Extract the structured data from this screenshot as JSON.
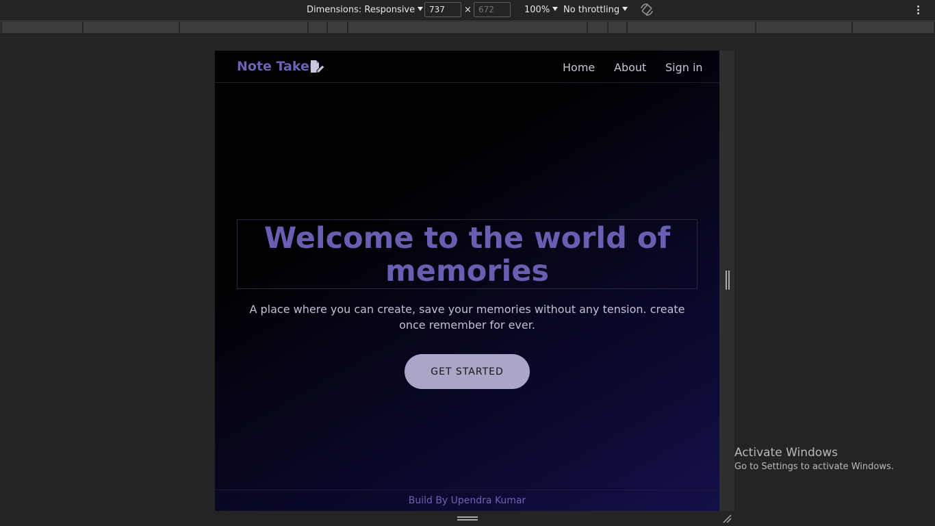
{
  "devtools": {
    "dimensions_label": "Dimensions: Responsive",
    "width_value": "737",
    "height_placeholder": "672",
    "times_sign": "×",
    "zoom_label": "100%",
    "throttling_label": "No throttling",
    "icons": [
      "rotate-icon",
      "kebab-menu-icon"
    ]
  },
  "site": {
    "brand": "Note Taker",
    "brand_icon": "note-edit-icon",
    "nav": [
      {
        "label": "Home"
      },
      {
        "label": "About"
      },
      {
        "label": "Sign in"
      }
    ],
    "hero": {
      "title": "Welcome to the world of memories",
      "subtitle": "A place where you can create, save your memories without any tension. create once remember for ever.",
      "cta_label": "GET STARTED"
    },
    "footer": "Build By Upendra Kumar",
    "colors": {
      "brand": "#6b63b5",
      "nav_text": "#c6c6d4",
      "cta_background": "#aaa6c7",
      "page_gradient_end": "#13104a"
    }
  },
  "watermark": {
    "title": "Activate Windows",
    "subtitle": "Go to Settings to activate Windows."
  }
}
